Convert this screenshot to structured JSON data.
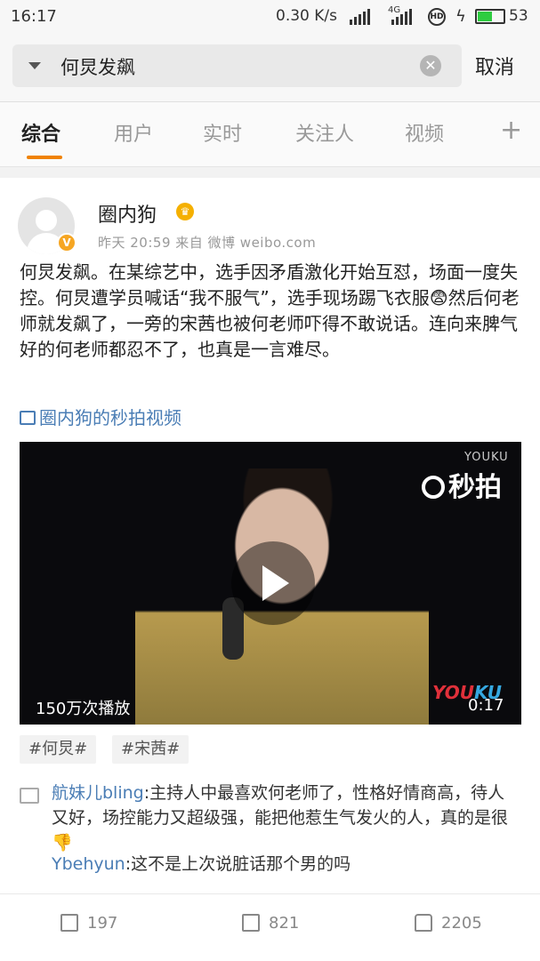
{
  "status_bar": {
    "time": "16:17",
    "net_speed": "0.30 K/s",
    "network_label": "4G",
    "battery_level": "53",
    "icons": [
      "signal-icon",
      "signal-4g-icon",
      "hd-icon",
      "charging-icon",
      "battery-icon"
    ]
  },
  "search": {
    "query": "何炅发飙",
    "cancel_label": "取消"
  },
  "tabs": [
    {
      "label": "综合",
      "active": true
    },
    {
      "label": "用户",
      "active": false
    },
    {
      "label": "实时",
      "active": false
    },
    {
      "label": "关注人",
      "active": false
    },
    {
      "label": "视频",
      "active": false
    }
  ],
  "accent_color": "#f08200",
  "post": {
    "username": "圈内狗",
    "verified_badge": "V",
    "meta": "昨天 20:59 来自 微博 weibo.com",
    "content": "何炅发飙。在某综艺中，选手因矛盾激化开始互怼，场面一度失控。何炅遭学员喊话“我不服气”，选手现场踢飞衣服😨然后何老师就发飙了，一旁的宋茜也被何老师吓得不敢说话。连向来脾气好的何老师都忍不了，也真是一言难尽。",
    "video_link": "圈内狗的秒拍视频",
    "video": {
      "watermark_top": "YOUKU",
      "watermark_brand": "秒拍",
      "watermark_bottom_a": "YOU",
      "watermark_bottom_b": "KU",
      "play_count": "150万次播放",
      "duration": "0:17"
    },
    "tags": [
      "#何炅#",
      "#宋茜#"
    ],
    "comments": [
      {
        "user": "航妹儿bling",
        "text": ":主持人中最喜欢何老师了，性格好情商高，待人又好，场控能力又超级强，能把他惹生气发火的人，真的是很👎"
      },
      {
        "user": "Ybehyun",
        "text": ":这不是上次说脏话那个男的吗"
      }
    ]
  },
  "actions": {
    "repost_count": "197",
    "comment_count": "821",
    "like_count": "2205"
  }
}
